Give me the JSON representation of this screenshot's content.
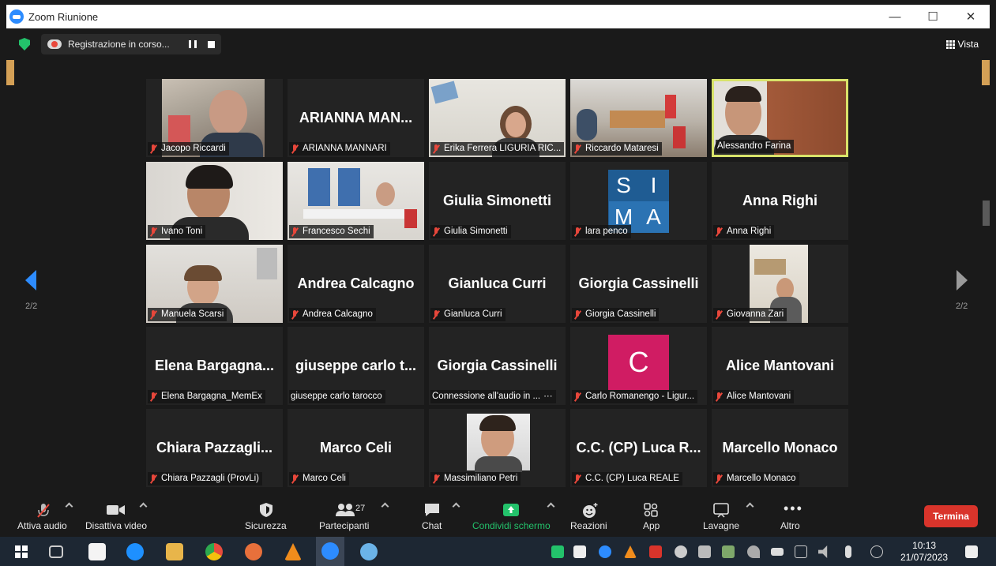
{
  "window": {
    "title": "Zoom Riunione"
  },
  "recording": {
    "label": "Registrazione in corso..."
  },
  "view": {
    "label": "Vista"
  },
  "pagination": {
    "left": "2/2",
    "right": "2/2"
  },
  "tiles": [
    {
      "label": "Jacopo Riccardi",
      "name": "",
      "muted": true
    },
    {
      "label": "ARIANNA MANNARI",
      "name": "ARIANNA  MAN...",
      "muted": true
    },
    {
      "label": "Erika Ferrera LIGURIA RIC...",
      "name": "",
      "muted": true
    },
    {
      "label": "Riccardo Mataresi",
      "name": "",
      "muted": true
    },
    {
      "label": "Alessandro Farina",
      "name": "",
      "muted": false,
      "active": true
    },
    {
      "label": "Ivano Toni",
      "name": "",
      "muted": true
    },
    {
      "label": "Francesco Sechi",
      "name": "",
      "muted": true
    },
    {
      "label": "Giulia Simonetti",
      "name": "Giulia Simonetti",
      "muted": true
    },
    {
      "label": "lara penco",
      "name": "",
      "muted": true,
      "logo_letters": [
        "S",
        "I",
        "M",
        "A"
      ]
    },
    {
      "label": "Anna Righi",
      "name": "Anna Righi",
      "muted": true
    },
    {
      "label": "Manuela Scarsi",
      "name": "",
      "muted": true
    },
    {
      "label": "Andrea Calcagno",
      "name": "Andrea Calcagno",
      "muted": true
    },
    {
      "label": "Gianluca Curri",
      "name": "Gianluca Curri",
      "muted": true
    },
    {
      "label": "Giorgia Cassinelli",
      "name": "Giorgia Cassinelli",
      "muted": true
    },
    {
      "label": "Giovanna Zari",
      "name": "",
      "muted": true
    },
    {
      "label": "Elena Bargagna_MemEx",
      "name": "Elena  Bargagna...",
      "muted": true
    },
    {
      "label": "giuseppe carlo tarocco",
      "name": "giuseppe  carlo  t...",
      "muted": false
    },
    {
      "label": "Connessione all'audio in ...",
      "name": "Giorgia Cassinelli",
      "muted": false,
      "connecting": true
    },
    {
      "label": "Carlo Romanengo - Ligur...",
      "name": "",
      "muted": true,
      "avatar_letter": "C"
    },
    {
      "label": "Alice Mantovani",
      "name": "Alice Mantovani",
      "muted": true
    },
    {
      "label": "Chiara Pazzagli (ProvLi)",
      "name": "Chiara  Pazzagli...",
      "muted": true
    },
    {
      "label": "Marco Celi",
      "name": "Marco Celi",
      "muted": true
    },
    {
      "label": "Massimiliano Petri",
      "name": "",
      "muted": true
    },
    {
      "label": "C.C. (CP) Luca REALE",
      "name": "C.C.  (CP)  Luca  R...",
      "muted": true
    },
    {
      "label": "Marcello Monaco",
      "name": "Marcello Monaco",
      "muted": true
    }
  ],
  "toolbar": {
    "audio": "Attiva audio",
    "video": "Disattiva video",
    "security": "Sicurezza",
    "participants": "Partecipanti",
    "participants_count": "27",
    "chat": "Chat",
    "share": "Condividi schermo",
    "reactions": "Reazioni",
    "apps": "App",
    "whiteboards": "Lavagne",
    "more": "Altro",
    "end": "Termina"
  },
  "taskbar": {
    "time": "10:13",
    "date": "21/07/2023"
  },
  "colors": {
    "accent": "#2D8CFF",
    "share_green": "#23c26b",
    "end_red": "#d9342b",
    "active_border": "#d8e36a",
    "muted_red": "#e8473b"
  }
}
